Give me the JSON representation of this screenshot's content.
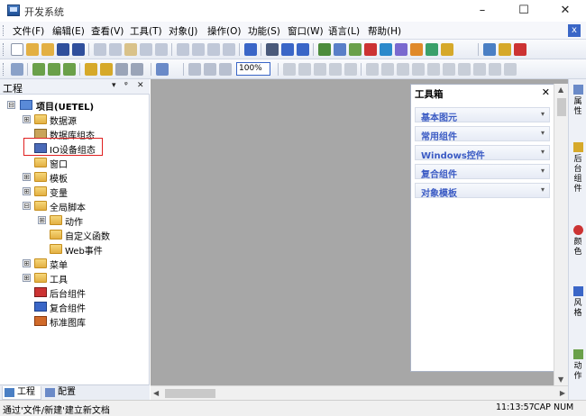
{
  "window": {
    "title": "开发系统",
    "minimize": "–",
    "maximize": "☐",
    "close": "✕"
  },
  "menu": [
    "文件(F)",
    "编辑(E)",
    "查看(V)",
    "工具(T)",
    "对象(J)",
    "操作(O)",
    "功能(S)",
    "窗口(W)",
    "语言(L)",
    "帮助(H)"
  ],
  "toolbar": {
    "zoom_value": "100%"
  },
  "project_panel": {
    "title": "工程",
    "controls": [
      "▾",
      "ᵠ",
      "✕"
    ],
    "tree": [
      {
        "label": "项目(UETEL)",
        "expander": "⊟",
        "bold": true
      },
      {
        "label": "数据源",
        "expander": "⊞"
      },
      {
        "label": "数据库组态",
        "expander": ""
      },
      {
        "label": "IO设备组态",
        "expander": ""
      },
      {
        "label": "窗口",
        "expander": ""
      },
      {
        "label": "模板",
        "expander": "⊞"
      },
      {
        "label": "变量",
        "expander": "⊞"
      },
      {
        "label": "全局脚本",
        "expander": "⊟"
      },
      {
        "label": "动作",
        "expander": "⊞"
      },
      {
        "label": "自定义函数",
        "expander": ""
      },
      {
        "label": "Web事件",
        "expander": ""
      },
      {
        "label": "菜单",
        "expander": "⊞"
      },
      {
        "label": "工具",
        "expander": "⊞"
      },
      {
        "label": "后台组件",
        "expander": ""
      },
      {
        "label": "复合组件",
        "expander": ""
      },
      {
        "label": "标准图库",
        "expander": ""
      }
    ],
    "tabs": [
      "工程",
      "配置"
    ]
  },
  "toolbox": {
    "title": "工具箱",
    "close": "✕",
    "categories": [
      "基本图元",
      "常用组件",
      "Windows控件",
      "复合组件",
      "对象模板"
    ],
    "arrow": "▾"
  },
  "right_rail": [
    "属性",
    "后台组件",
    "颜色",
    "风格",
    "动作"
  ],
  "statusbar": {
    "message": "通过'文件/新建'建立新文档",
    "time": "11:13:57",
    "caps": "CAP",
    "num": "NUM"
  },
  "colors": {
    "accent": "#3a66c7",
    "highlight_box": "#e02020",
    "folder": "#e3b043",
    "canvas": "#a7a7a7"
  }
}
